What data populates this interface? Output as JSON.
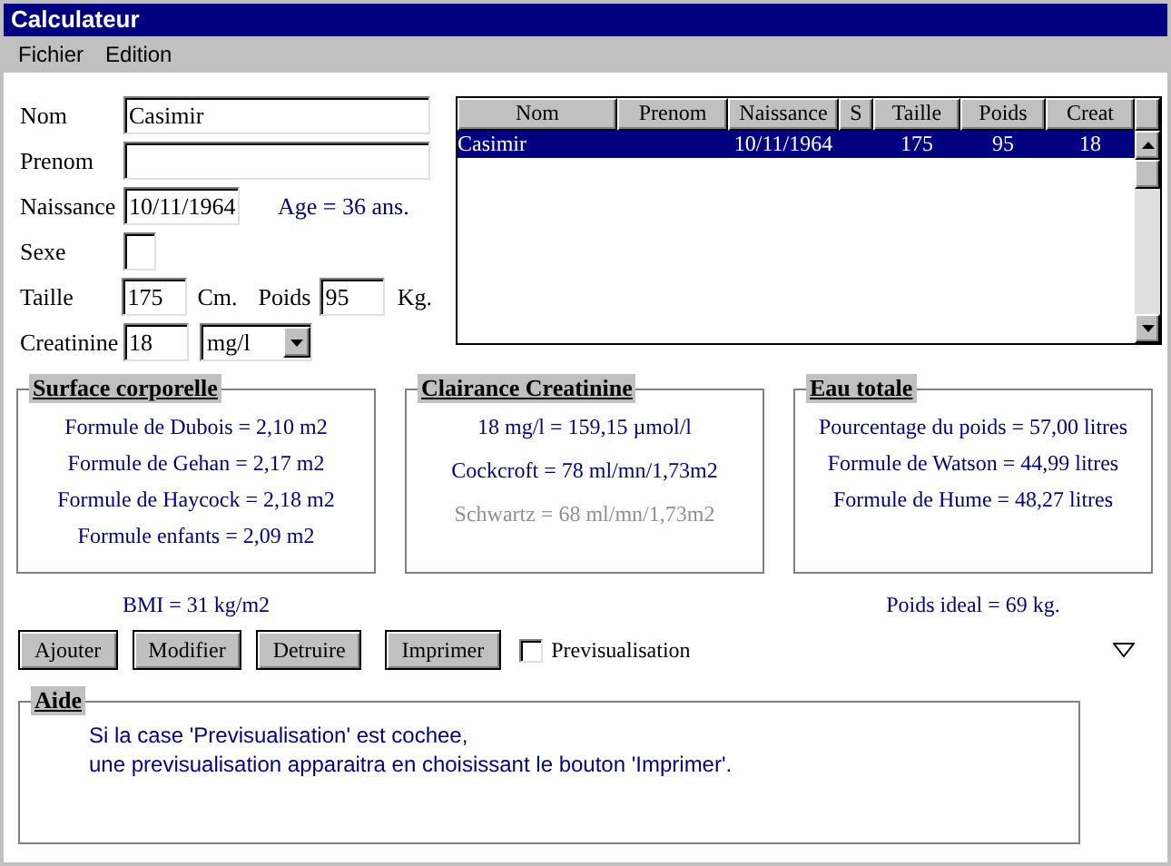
{
  "window": {
    "title": "Calculateur"
  },
  "menu": [
    "Fichier",
    "Edition"
  ],
  "form": {
    "nom": {
      "label": "Nom",
      "value": "Casimir"
    },
    "prenom": {
      "label": "Prenom"
    },
    "naissance": {
      "label": "Naissance",
      "value": "10/11/1964"
    },
    "age": "Age = 36 ans.",
    "sexe": {
      "label": "Sexe"
    },
    "taille": {
      "label": "Taille",
      "value": "175",
      "unit": "Cm."
    },
    "poids": {
      "label": "Poids",
      "value": "95",
      "unit": "Kg."
    },
    "creatinine": {
      "label": "Creatinine",
      "value": "18",
      "unit": "mg/l"
    }
  },
  "table": {
    "columns": [
      "Nom",
      "Prenom",
      "Naissance",
      "S",
      "Taille",
      "Poids",
      "Creat"
    ],
    "rows": [
      {
        "nom": "Casimir",
        "naissance": "10/11/1964",
        "taille": "175",
        "poids": "95",
        "creat": "18",
        "selected": true
      }
    ]
  },
  "groups": [
    {
      "title": "Surface corporelle",
      "lines": [
        {
          "text": "Formule de Dubois = 2,10 m2",
          "disabled": false
        },
        {
          "text": "Formule de Gehan = 2,17 m2",
          "disabled": false
        },
        {
          "text": "Formule de Haycock = 2,18 m2",
          "disabled": false
        },
        {
          "text": "Formule enfants = 2,09 m2",
          "disabled": false
        }
      ],
      "footer": "BMI = 31 kg/m2"
    },
    {
      "title": "Clairance Creatinine",
      "lines": [
        {
          "text": "18 mg/l = 159,15 µmol/l",
          "disabled": false
        },
        {
          "text": "Cockcroft = 78  ml/mn/1,73m2",
          "disabled": false
        },
        {
          "text": "Schwartz = 68  ml/mn/1,73m2",
          "disabled": true
        }
      ]
    },
    {
      "title": "Eau totale",
      "lines": [
        {
          "text": "Pourcentage du poids = 57,00 litres",
          "disabled": false
        },
        {
          "text": "Formule de Watson = 44,99 litres",
          "disabled": false
        },
        {
          "text": "Formule de Hume = 48,27 litres",
          "disabled": false
        }
      ],
      "footer": "Poids ideal = 69 kg."
    }
  ],
  "buttons": [
    "Ajouter",
    "Modifier",
    "Detruire",
    "Imprimer"
  ],
  "preview": {
    "label": "Previsualisation",
    "checked": false
  },
  "aide": {
    "title": "Aide",
    "lines": [
      "Si la case 'Previsualisation' est cochee,",
      "une previsualisation apparaitra en choisissant le bouton 'Imprimer'."
    ]
  }
}
